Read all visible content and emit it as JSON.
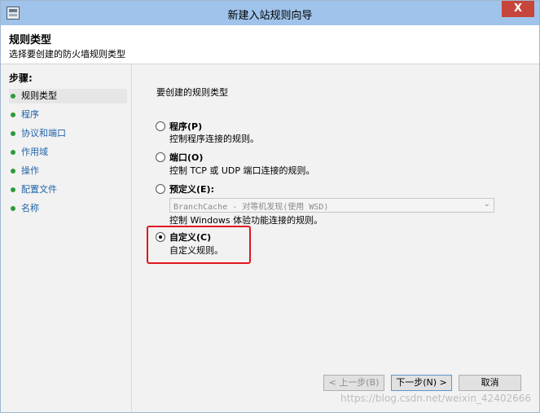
{
  "window": {
    "title": "新建入站规则向导",
    "close_glyph": "X"
  },
  "header": {
    "title": "规则类型",
    "description": "选择要创建的防火墙规则类型"
  },
  "steps": {
    "label": "步骤:",
    "items": [
      {
        "label": "规则类型",
        "active": true
      },
      {
        "label": "程序"
      },
      {
        "label": "协议和端口"
      },
      {
        "label": "作用域"
      },
      {
        "label": "操作"
      },
      {
        "label": "配置文件"
      },
      {
        "label": "名称"
      }
    ]
  },
  "main": {
    "question": "要创建的规则类型",
    "options": [
      {
        "label": "程序(P)",
        "description": "控制程序连接的规则。",
        "checked": false
      },
      {
        "label": "端口(O)",
        "description": "控制 TCP 或 UDP 端口连接的规则。",
        "checked": false
      },
      {
        "label": "预定义(E):",
        "description": "控制 Windows 体验功能连接的规则。",
        "checked": false,
        "dropdown_value": "BranchCache - 对等机发现(使用 WSD)"
      },
      {
        "label": "自定义(C)",
        "description": "自定义规则。",
        "checked": true
      }
    ]
  },
  "buttons": {
    "back": "< 上一步(B)",
    "next": "下一步(N) >",
    "cancel": "取消"
  },
  "watermark": "https://blog.csdn.net/weixin_42402666"
}
